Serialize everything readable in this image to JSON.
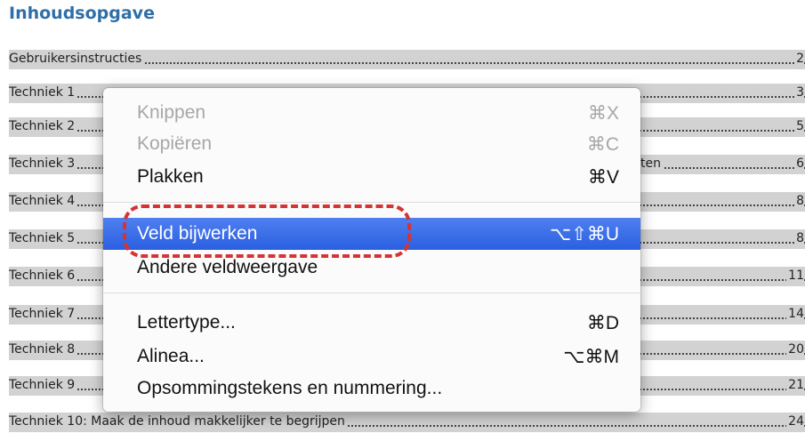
{
  "document": {
    "title": "Inhoudsopgave",
    "toc": [
      {
        "title": "Gebruikersinstructies",
        "page": "2"
      },
      {
        "title": "Techniek 1",
        "page": "3"
      },
      {
        "title": "Techniek 2",
        "page": "5"
      },
      {
        "title": "Techniek 3",
        "tail": "ten",
        "page": "6"
      },
      {
        "title": "Techniek 4",
        "page": "8"
      },
      {
        "title": "Techniek 5",
        "page": "8"
      },
      {
        "title": "Techniek 6",
        "page": "11"
      },
      {
        "title": "Techniek 7",
        "page": "14"
      },
      {
        "title": "Techniek 8",
        "page": "20"
      },
      {
        "title": "Techniek 9",
        "page": "21"
      },
      {
        "title": "Techniek 10: Maak de inhoud makkelijker te begrijpen",
        "page": "24"
      }
    ]
  },
  "context_menu": {
    "items": [
      {
        "label": "Knippen",
        "shortcut": "⌘X",
        "state": "disabled"
      },
      {
        "label": "Kopiëren",
        "shortcut": "⌘C",
        "state": "disabled"
      },
      {
        "label": "Plakken",
        "shortcut": "⌘V",
        "state": "enabled"
      },
      {
        "label": "Veld bijwerken",
        "shortcut": "⌥⇧⌘U",
        "state": "selected"
      },
      {
        "label": "Andere veldweergave",
        "shortcut": "",
        "state": "enabled"
      },
      {
        "label": "Lettertype...",
        "shortcut": "⌘D",
        "state": "enabled"
      },
      {
        "label": "Alinea...",
        "shortcut": "⌥⌘M",
        "state": "enabled"
      },
      {
        "label": "Opsommingstekens en nummering...",
        "shortcut": "",
        "state": "enabled"
      }
    ]
  },
  "colors": {
    "title": "#2f6ea8",
    "selection": "#2a5fe0",
    "annotation": "#d63333",
    "toc_field_shading": "#d2d2d2"
  }
}
